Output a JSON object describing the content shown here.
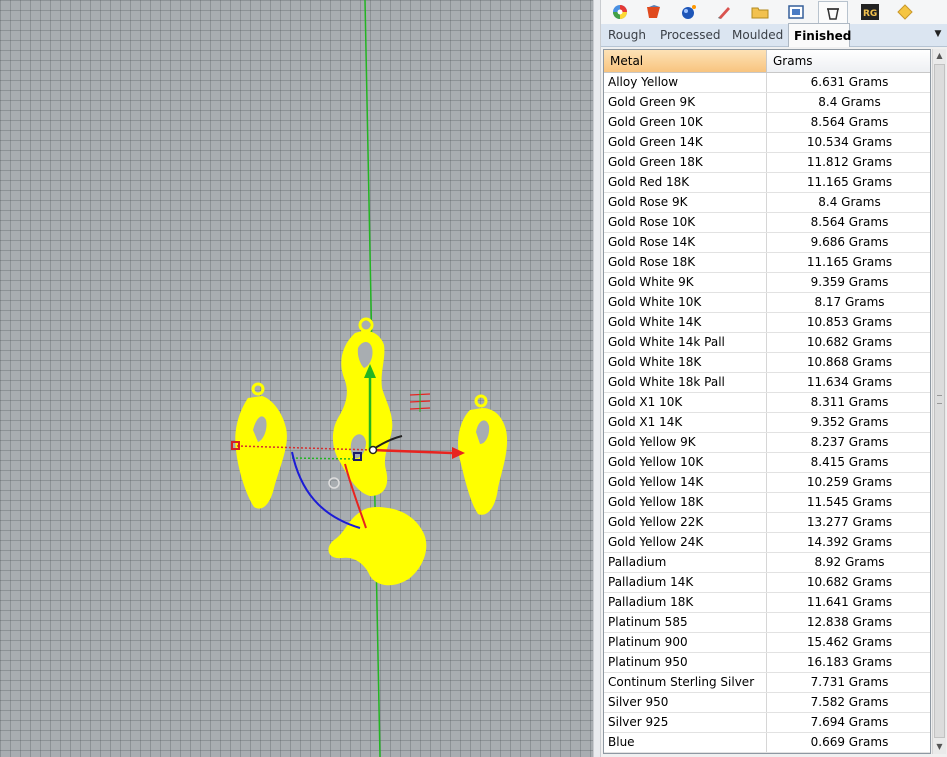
{
  "toolbar": {
    "icons": [
      "color-wheel-icon",
      "material-icon",
      "sphere-render-icon",
      "pen-icon",
      "folder-icon",
      "image-icon",
      "metal-weight-icon",
      "rg-icon",
      "gem-icon"
    ]
  },
  "tabs": [
    {
      "label": "Rough",
      "selected": false
    },
    {
      "label": "Processed",
      "selected": false
    },
    {
      "label": "Moulded",
      "selected": false
    },
    {
      "label": "Finished",
      "selected": true
    }
  ],
  "table": {
    "columns": [
      "Metal",
      "Grams"
    ],
    "rows": [
      [
        "Alloy Yellow",
        "6.631 Grams"
      ],
      [
        "Gold Green 9K",
        "8.4 Grams"
      ],
      [
        "Gold Green 10K",
        "8.564 Grams"
      ],
      [
        "Gold Green 14K",
        "10.534 Grams"
      ],
      [
        "Gold Green 18K",
        "11.812 Grams"
      ],
      [
        "Gold Red 18K",
        "11.165 Grams"
      ],
      [
        "Gold Rose 9K",
        "8.4 Grams"
      ],
      [
        "Gold Rose 10K",
        "8.564 Grams"
      ],
      [
        "Gold Rose 14K",
        "9.686 Grams"
      ],
      [
        "Gold Rose 18K",
        "11.165 Grams"
      ],
      [
        "Gold White 9K",
        "9.359 Grams"
      ],
      [
        "Gold White 10K",
        "8.17 Grams"
      ],
      [
        "Gold White 14K",
        "10.853 Grams"
      ],
      [
        "Gold White 14k Pall",
        "10.682 Grams"
      ],
      [
        "Gold White 18K",
        "10.868 Grams"
      ],
      [
        "Gold White 18k Pall",
        "11.634 Grams"
      ],
      [
        "Gold X1 10K",
        "8.311 Grams"
      ],
      [
        "Gold X1 14K",
        "9.352 Grams"
      ],
      [
        "Gold Yellow 9K",
        "8.237 Grams"
      ],
      [
        "Gold Yellow 10K",
        "8.415 Grams"
      ],
      [
        "Gold Yellow 14K",
        "10.259 Grams"
      ],
      [
        "Gold Yellow 18K",
        "11.545 Grams"
      ],
      [
        "Gold Yellow 22K",
        "13.277 Grams"
      ],
      [
        "Gold Yellow 24K",
        "14.392 Grams"
      ],
      [
        "Palladium",
        "8.92 Grams"
      ],
      [
        "Palladium 14K",
        "10.682 Grams"
      ],
      [
        "Palladium 18K",
        "11.641 Grams"
      ],
      [
        "Platinum 585",
        "12.838 Grams"
      ],
      [
        "Platinum 900",
        "15.462 Grams"
      ],
      [
        "Platinum 950",
        "16.183 Grams"
      ],
      [
        "Continum Sterling Silver",
        "7.731 Grams"
      ],
      [
        "Silver 950",
        "7.582 Grams"
      ],
      [
        "Silver 925",
        "7.694 Grams"
      ],
      [
        "Blue",
        "0.669 Grams"
      ]
    ]
  },
  "colors": {
    "object_yellow": "#ffff00",
    "axis_green": "#22b522",
    "axis_red": "#e8231f",
    "axis_blue": "#1c1cd6",
    "viewport_bg": "#a8adb1",
    "header_highlight": "#f8c47f"
  }
}
